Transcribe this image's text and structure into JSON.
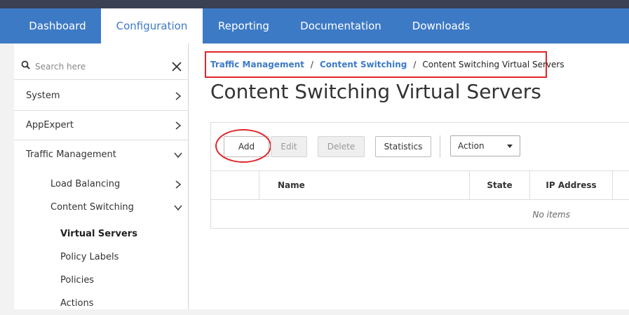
{
  "top_nav": {
    "tabs": [
      {
        "label": "Dashboard"
      },
      {
        "label": "Configuration",
        "active": true
      },
      {
        "label": "Reporting"
      },
      {
        "label": "Documentation"
      },
      {
        "label": "Downloads"
      }
    ]
  },
  "sidebar": {
    "search": {
      "placeholder": "Search here"
    },
    "items": [
      {
        "label": "System",
        "state": "collapsed"
      },
      {
        "label": "AppExpert",
        "state": "collapsed"
      },
      {
        "label": "Traffic Management",
        "state": "expanded"
      }
    ],
    "sub_items": [
      {
        "label": "Load Balancing",
        "state": "collapsed"
      },
      {
        "label": "Content Switching",
        "state": "expanded"
      }
    ],
    "leaf_items": [
      {
        "label": "Virtual Servers",
        "selected": true
      },
      {
        "label": "Policy Labels"
      },
      {
        "label": "Policies"
      },
      {
        "label": "Actions"
      }
    ]
  },
  "breadcrumb": {
    "items": [
      "Traffic Management",
      "Content Switching"
    ],
    "separator": "/",
    "current": "Content Switching Virtual Servers"
  },
  "page_title": "Content Switching Virtual Servers",
  "toolbar": {
    "add": "Add",
    "edit": "Edit",
    "delete": "Delete",
    "statistics": "Statistics",
    "action_select": "Action"
  },
  "table": {
    "columns": [
      "Name",
      "State",
      "IP Address"
    ],
    "empty_text": "No items"
  },
  "colors": {
    "nav_blue": "#3d7ac6",
    "highlight_red": "#e0262b",
    "topstrip": "#3a4152"
  }
}
